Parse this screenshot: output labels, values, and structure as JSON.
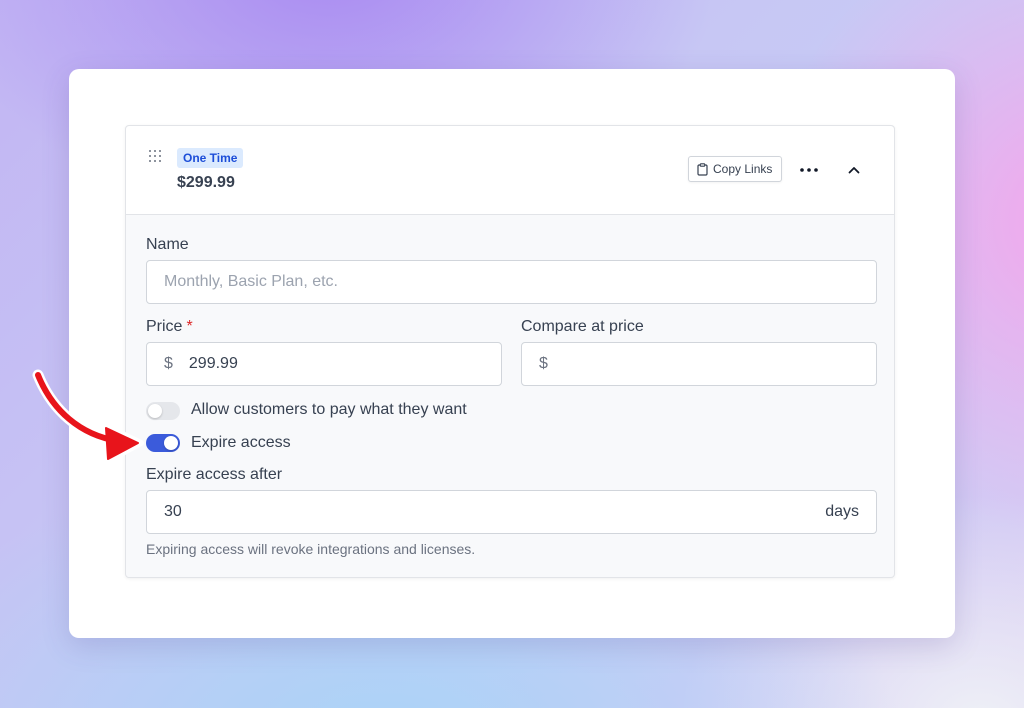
{
  "variant": {
    "badge": "One Time",
    "price_display": "$299.99",
    "copy_links_label": "Copy Links"
  },
  "form": {
    "name_label": "Name",
    "name_placeholder": "Monthly, Basic Plan, etc.",
    "price_label": "Price",
    "price_required_mark": "*",
    "price_prefix": "$",
    "price_value": "299.99",
    "compare_label": "Compare at price",
    "compare_prefix": "$",
    "pay_what_you_want_label": "Allow customers to pay what they want",
    "pay_what_you_want_on": false,
    "expire_access_label": "Expire access",
    "expire_access_on": true,
    "expire_after_label": "Expire access after",
    "expire_after_value": "30",
    "expire_after_unit": "days",
    "expire_help_text": "Expiring access will revoke integrations and licenses."
  },
  "colors": {
    "accent": "#3b5bdb",
    "badge_bg": "#dbeafe",
    "badge_text": "#1d4ed8",
    "annotation_arrow": "#e8141b",
    "required": "#dc2626"
  },
  "icons": {
    "drag": "drag-handle-icon",
    "copy": "clipboard-icon",
    "more": "more-horizontal-icon",
    "collapse": "chevron-up-icon",
    "annotation": "red-arrow-annotation"
  }
}
